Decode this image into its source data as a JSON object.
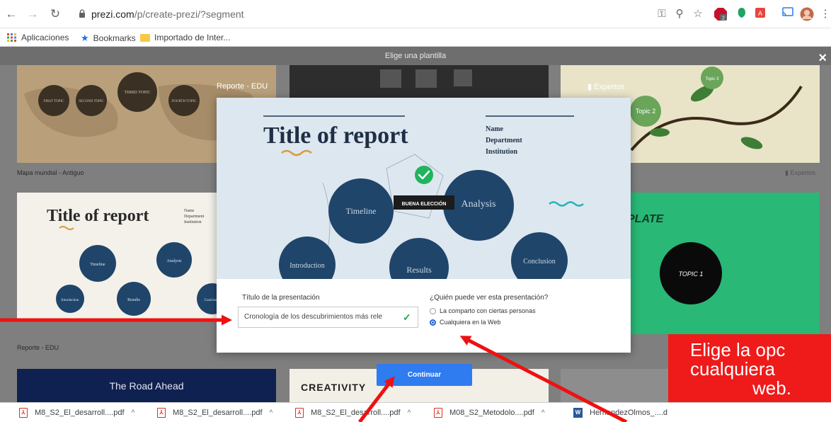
{
  "browser": {
    "url_domain": "prezi.com",
    "url_path": "/p/create-prezi/?segment",
    "bookmarks": [
      "Aplicaciones",
      "Bookmarks",
      "Importado de Inter..."
    ],
    "ext_badge": "2"
  },
  "page": {
    "header_title": "Elige una plantilla",
    "close_label": "×"
  },
  "templates": [
    {
      "caption": "Mapa mundial - Antiguo",
      "topics": [
        "FIRST TOPIC",
        "SECOND TOPIC",
        "THIRD TOPIC",
        "FOURTH TOPIC"
      ]
    },
    {
      "caption": "Reporte - EDU",
      "title": "Title of report",
      "header": [
        "Name",
        "Department",
        "Institution"
      ],
      "topics": [
        "Timeline",
        "Analysis",
        "Introduction",
        "Results",
        "Conclusion"
      ]
    },
    {
      "caption": "The Road Ahead"
    },
    {
      "caption": "CREATIVITY"
    },
    {
      "topics": [
        "Topic 2",
        "Topic 3"
      ],
      "badge": "Expertos"
    },
    {
      "title": "PLATE",
      "topics": [
        "TOPIC 1"
      ]
    }
  ],
  "modal": {
    "template_name": "Reporte - EDU",
    "badge": "Expertos",
    "preview_title": "Title of report",
    "preview_header": [
      "Name",
      "Department",
      "Institution"
    ],
    "topics": [
      "Timeline",
      "Analysis",
      "Introduction",
      "Results",
      "Conclusion"
    ],
    "good_choice": "BUENA ELECCIÓN",
    "title_label": "Título de la presentación",
    "title_value": "Cronología de los descubrimientos más rele",
    "visibility_label": "¿Quién puede ver esta presentación?",
    "option_private": "La comparto con ciertas personas",
    "option_public": "Cualquiera en la Web",
    "selected": "public"
  },
  "continue_label": "Continuar",
  "callout": {
    "lines": [
      "Elige la opc",
      "cualquiera",
      "web."
    ],
    "color": "#ef1a1a"
  },
  "downloads": [
    "M8_S2_El_desarroll....pdf",
    "M8_S2_El_desarroll....pdf",
    "M8_S2_El_desarroll....pdf",
    "M08_S2_Metodolo....pdf",
    "HernandezOlmos_....d"
  ],
  "colors": {
    "accent": "#2f7bf0",
    "check": "#23a35a",
    "arrow": "#ee1111",
    "topic_circle": "#20456a"
  }
}
